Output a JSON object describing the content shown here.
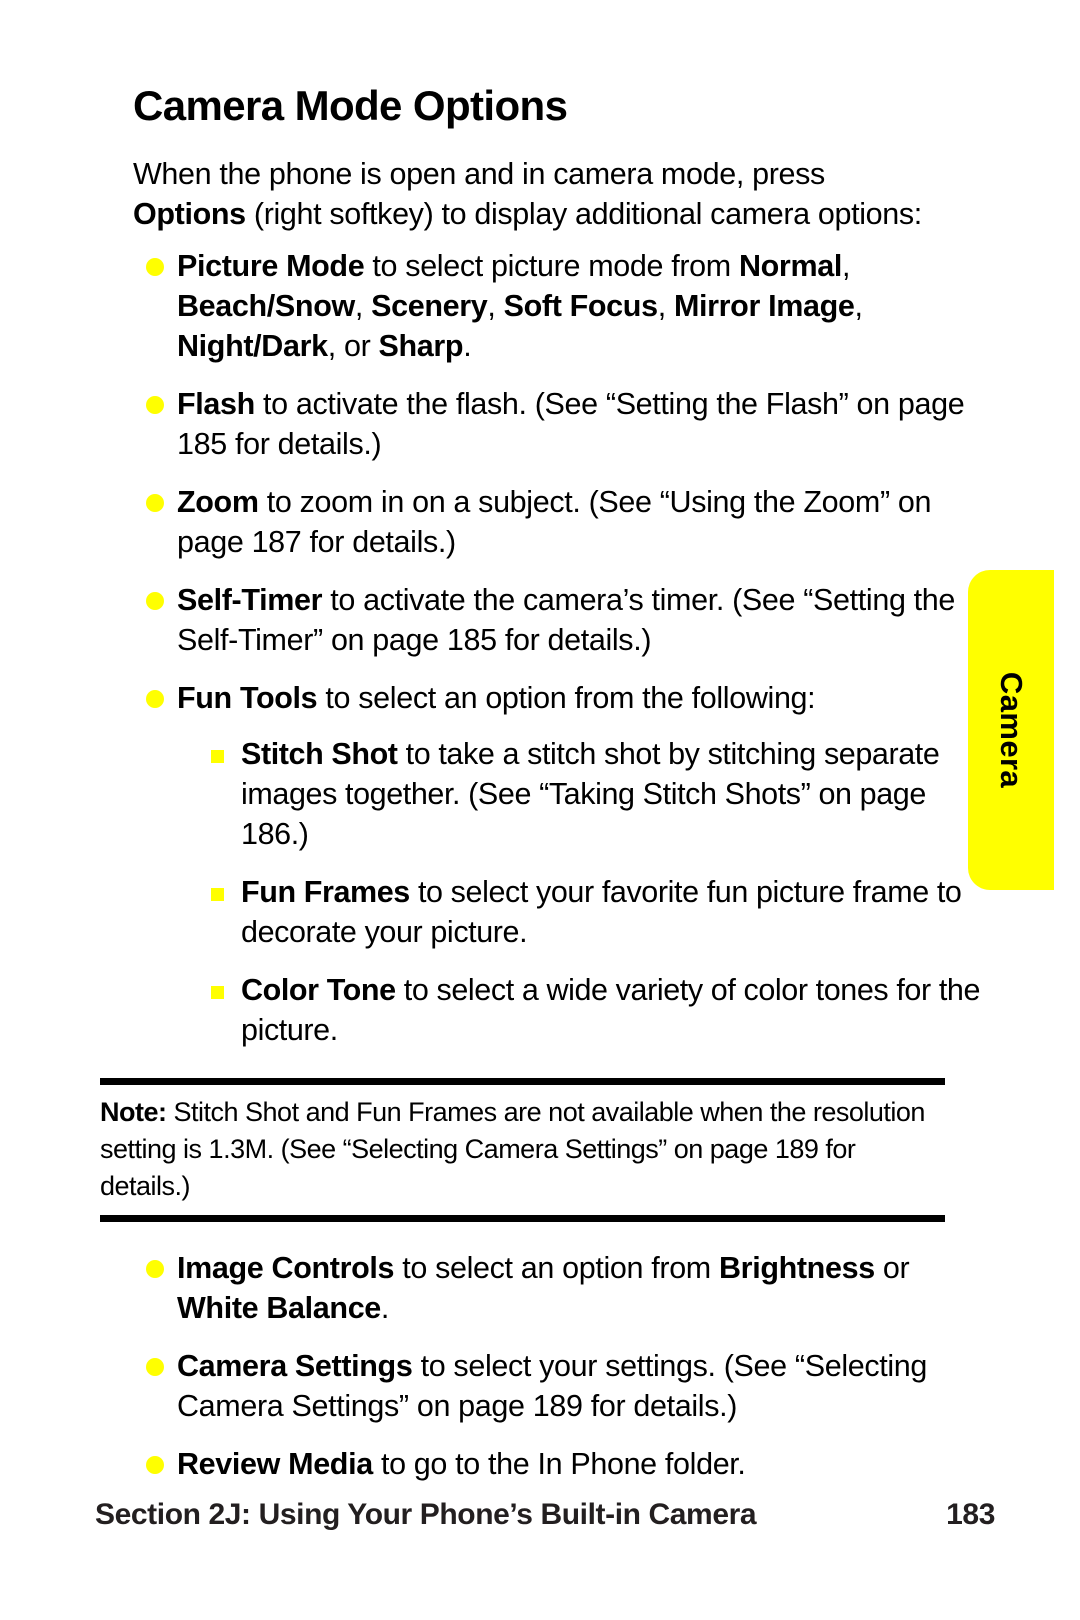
{
  "page": {
    "title": "Camera Mode Options",
    "intro_html": "When the phone is open and in camera mode, press <b>Options</b> (right softkey) to display additional camera options:",
    "side_tab_label": "Camera",
    "accent_color": "#FFFF00",
    "text_color": "#000000"
  },
  "bullets_before_note": [
    {
      "name": "picture-mode",
      "html": "<b>Picture Mode</b> to select picture mode from <b>Normal</b>, <b>Beach/Snow</b>, <b>Scenery</b>, <b>Soft Focus</b>, <b>Mirror Image</b>, <b>Night/Dark</b>, or <b>Sharp</b>."
    },
    {
      "name": "flash",
      "html": "<b>Flash</b> to activate the flash. (See “Setting the Flash” on page 185 for details.)"
    },
    {
      "name": "zoom",
      "html": "<b>Zoom</b> to zoom in on a subject. (See “Using the Zoom” on page 187 for details.)"
    },
    {
      "name": "self-timer",
      "html": "<b>Self-Timer</b> to activate the camera’s timer. (See “Setting the Self-Timer” on page 185 for details.)"
    },
    {
      "name": "fun-tools",
      "html": "<b>Fun Tools</b> to select an option from the following:"
    }
  ],
  "sub_bullets": [
    {
      "name": "stitch-shot",
      "html": "<b>Stitch Shot</b> to take a stitch shot by stitching separate images together. (See “Taking Stitch Shots” on page 186.)"
    },
    {
      "name": "fun-frames",
      "html": "<b>Fun Frames</b> to select your favorite fun picture frame to decorate your picture."
    },
    {
      "name": "color-tone",
      "html": "<b>Color Tone</b> to select a wide variety of color tones for the picture."
    }
  ],
  "note": {
    "label": "Note:",
    "html": "<b>Note:</b> Stitch Shot and Fun Frames are not available when the resolution setting is 1.3M. (See “Selecting Camera Settings” on page 189 for details.)"
  },
  "bullets_after_note": [
    {
      "name": "image-controls",
      "html": "<b>Image Controls</b> to select an option from <b>Brightness</b> or <b>White Balance</b>."
    },
    {
      "name": "camera-settings",
      "html": "<b>Camera Settings</b> to select your settings. (See “Selecting Camera Settings” on page 189 for details.)"
    },
    {
      "name": "review-media",
      "html": "<b>Review Media</b> to go to the In Phone folder."
    }
  ],
  "footer": {
    "section": "Section 2J: Using Your Phone’s Built-in Camera",
    "page_number": "183"
  }
}
